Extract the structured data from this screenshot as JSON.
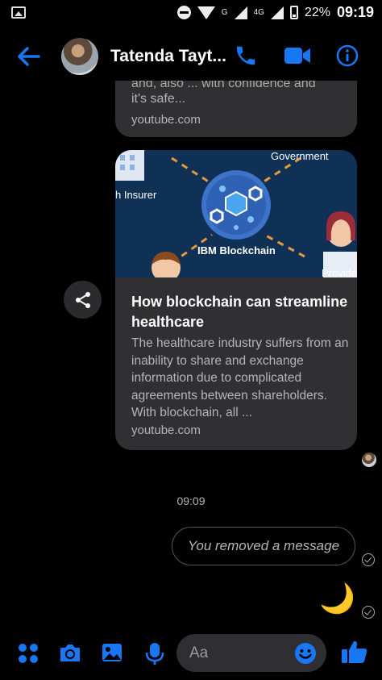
{
  "status_bar": {
    "network_g": "G",
    "network_4g": "4G",
    "battery": "22%",
    "time": "09:19"
  },
  "header": {
    "contact_name": "Tatenda Tayt...",
    "accent_color": "#1877f2"
  },
  "messages": {
    "previous_card": {
      "cut_text": "and, also ... with confidence and",
      "description_tail": "it's safe...",
      "domain": "youtube.com"
    },
    "link_card": {
      "image_labels": {
        "government": "Government",
        "insurer": "h Insurer",
        "center": "IBM Blockchain",
        "provider": "Provide"
      },
      "title": "How blockchain can streamline healthcare",
      "description": "The healthcare industry suffers from an inability to share and exchange information due to complicated agreements between shareholders. With blockchain, all ...",
      "domain": "youtube.com"
    },
    "timestamp": "09:09",
    "removed_message": "You removed a message",
    "sticker": "moon-sticker"
  },
  "composer": {
    "placeholder": "Aa"
  }
}
